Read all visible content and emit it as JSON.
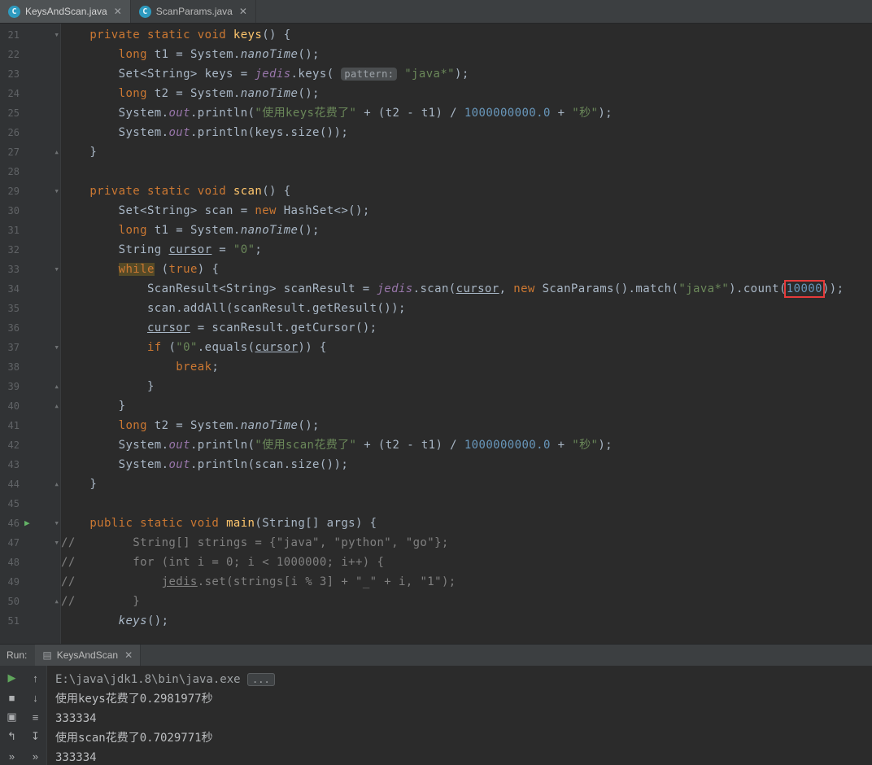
{
  "colors": {
    "editor_bg": "#2b2b2b",
    "gutter_bg": "#313335",
    "tabbar_bg": "#3c3f41",
    "keyword": "#cc7832",
    "string": "#6a8759",
    "number": "#6897bb",
    "field": "#9876aa",
    "comment": "#808080",
    "foreground": "#a9b7c6",
    "method_decl": "#ffc66d",
    "run_green": "#64b467",
    "annotation_red": "#e43b3b"
  },
  "editor_tabs": [
    {
      "label": "KeysAndScan.java",
      "active": true,
      "close": "✕"
    },
    {
      "label": "ScanParams.java",
      "active": false,
      "close": "✕"
    }
  ],
  "editor": {
    "lines": [
      {
        "num": 21,
        "fold": "open",
        "tokens": [
          [
            "kw",
            "    private static void "
          ],
          [
            "fn",
            "keys"
          ],
          [
            "pl",
            "() {"
          ]
        ]
      },
      {
        "num": 22,
        "tokens": [
          [
            "pl",
            "        "
          ],
          [
            "kw",
            "long"
          ],
          [
            "pl",
            " t1 = System."
          ],
          [
            "it",
            "nanoTime"
          ],
          [
            "pl",
            "();"
          ]
        ]
      },
      {
        "num": 23,
        "tokens": [
          [
            "pl",
            "        Set<String> keys = "
          ],
          [
            "field",
            "jedis"
          ],
          [
            "pl",
            ".keys( "
          ],
          [
            "hint",
            "pattern:"
          ],
          [
            "pl",
            " "
          ],
          [
            "str",
            "\"java*\""
          ],
          [
            "pl",
            ");"
          ]
        ]
      },
      {
        "num": 24,
        "tokens": [
          [
            "pl",
            "        "
          ],
          [
            "kw",
            "long"
          ],
          [
            "pl",
            " t2 = System."
          ],
          [
            "it",
            "nanoTime"
          ],
          [
            "pl",
            "();"
          ]
        ]
      },
      {
        "num": 25,
        "tokens": [
          [
            "pl",
            "        System."
          ],
          [
            "field",
            "out"
          ],
          [
            "pl",
            ".println("
          ],
          [
            "str",
            "\"使用keys花费了\""
          ],
          [
            "pl",
            " + (t2 - t1) / "
          ],
          [
            "num",
            "1000000000.0"
          ],
          [
            "pl",
            " + "
          ],
          [
            "str",
            "\"秒\""
          ],
          [
            "pl",
            ");"
          ]
        ]
      },
      {
        "num": 26,
        "tokens": [
          [
            "pl",
            "        System."
          ],
          [
            "field",
            "out"
          ],
          [
            "pl",
            ".println(keys.size());"
          ]
        ]
      },
      {
        "num": 27,
        "fold": "end",
        "tokens": [
          [
            "pl",
            "    }"
          ]
        ]
      },
      {
        "num": 28,
        "tokens": []
      },
      {
        "num": 29,
        "fold": "open",
        "tokens": [
          [
            "kw",
            "    private static void "
          ],
          [
            "fn",
            "scan"
          ],
          [
            "pl",
            "() {"
          ]
        ]
      },
      {
        "num": 30,
        "tokens": [
          [
            "pl",
            "        Set<String> scan = "
          ],
          [
            "kw",
            "new"
          ],
          [
            "pl",
            " HashSet<>();"
          ]
        ]
      },
      {
        "num": 31,
        "tokens": [
          [
            "pl",
            "        "
          ],
          [
            "kw",
            "long"
          ],
          [
            "pl",
            " t1 = System."
          ],
          [
            "it",
            "nanoTime"
          ],
          [
            "pl",
            "();"
          ]
        ]
      },
      {
        "num": 32,
        "tokens": [
          [
            "pl",
            "        String "
          ],
          [
            "ul",
            "cursor"
          ],
          [
            "pl",
            " = "
          ],
          [
            "str",
            "\"0\""
          ],
          [
            "pl",
            ";"
          ]
        ]
      },
      {
        "num": 33,
        "fold": "open",
        "tokens": [
          [
            "pl",
            "        "
          ],
          [
            "kw hl",
            "while"
          ],
          [
            "pl",
            " ("
          ],
          [
            "kw",
            "true"
          ],
          [
            "pl",
            ") {"
          ]
        ]
      },
      {
        "num": 34,
        "tokens": [
          [
            "pl",
            "            ScanResult<String> scanResult = "
          ],
          [
            "field",
            "jedis"
          ],
          [
            "pl",
            ".scan("
          ],
          [
            "ul",
            "cursor"
          ],
          [
            "pl",
            ", "
          ],
          [
            "kw",
            "new"
          ],
          [
            "pl",
            " ScanParams().match("
          ],
          [
            "str",
            "\"java*\""
          ],
          [
            "pl",
            ").count("
          ],
          [
            "num red",
            "10000"
          ],
          [
            "pl",
            "));"
          ]
        ]
      },
      {
        "num": 35,
        "tokens": [
          [
            "pl",
            "            scan.addAll(scanResult.getResult());"
          ]
        ]
      },
      {
        "num": 36,
        "tokens": [
          [
            "pl",
            "            "
          ],
          [
            "ul",
            "cursor"
          ],
          [
            "pl",
            " = scanResult.getCursor();"
          ]
        ]
      },
      {
        "num": 37,
        "fold": "open",
        "tokens": [
          [
            "pl",
            "            "
          ],
          [
            "kw",
            "if"
          ],
          [
            "pl",
            " ("
          ],
          [
            "str",
            "\"0\""
          ],
          [
            "pl",
            ".equals("
          ],
          [
            "ul",
            "cursor"
          ],
          [
            "pl",
            ")) {"
          ]
        ]
      },
      {
        "num": 38,
        "tokens": [
          [
            "pl",
            "                "
          ],
          [
            "kw",
            "break"
          ],
          [
            "pl",
            ";"
          ]
        ]
      },
      {
        "num": 39,
        "fold": "end",
        "tokens": [
          [
            "pl",
            "            }"
          ]
        ]
      },
      {
        "num": 40,
        "fold": "end",
        "tokens": [
          [
            "pl",
            "        }"
          ]
        ]
      },
      {
        "num": 41,
        "tokens": [
          [
            "pl",
            "        "
          ],
          [
            "kw",
            "long"
          ],
          [
            "pl",
            " t2 = System."
          ],
          [
            "it",
            "nanoTime"
          ],
          [
            "pl",
            "();"
          ]
        ]
      },
      {
        "num": 42,
        "tokens": [
          [
            "pl",
            "        System."
          ],
          [
            "field",
            "out"
          ],
          [
            "pl",
            ".println("
          ],
          [
            "str",
            "\"使用scan花费了\""
          ],
          [
            "pl",
            " + (t2 - t1) / "
          ],
          [
            "num",
            "1000000000.0"
          ],
          [
            "pl",
            " + "
          ],
          [
            "str",
            "\"秒\""
          ],
          [
            "pl",
            ");"
          ]
        ]
      },
      {
        "num": 43,
        "tokens": [
          [
            "pl",
            "        System."
          ],
          [
            "field",
            "out"
          ],
          [
            "pl",
            ".println(scan.size());"
          ]
        ]
      },
      {
        "num": 44,
        "fold": "end",
        "tokens": [
          [
            "pl",
            "    }"
          ]
        ]
      },
      {
        "num": 45,
        "tokens": []
      },
      {
        "num": 46,
        "fold": "open",
        "run": true,
        "tokens": [
          [
            "kw",
            "    public static void "
          ],
          [
            "fn",
            "main"
          ],
          [
            "pl",
            "(String[] args) {"
          ]
        ]
      },
      {
        "num": 47,
        "fold": "open",
        "tokens": [
          [
            "cm",
            "//        String[] strings = {\"java\", \"python\", \"go\"};"
          ]
        ]
      },
      {
        "num": 48,
        "tokens": [
          [
            "cm",
            "//        for (int i = 0; i < 1000000; i++) {"
          ]
        ]
      },
      {
        "num": 49,
        "tokens": [
          [
            "cm",
            "//            "
          ],
          [
            "cm ul",
            "jedis"
          ],
          [
            "cm",
            ".set(strings[i % 3] + \"_\" + i, \"1\");"
          ]
        ]
      },
      {
        "num": 50,
        "fold": "end",
        "tokens": [
          [
            "cm",
            "//        }"
          ]
        ]
      },
      {
        "num": 51,
        "tokens": [
          [
            "pl",
            "        "
          ],
          [
            "it",
            "keys"
          ],
          [
            "pl",
            "();"
          ]
        ]
      }
    ]
  },
  "run_panel": {
    "label": "Run:",
    "tab": "KeysAndScan",
    "tab_close": "✕",
    "toolbar": [
      {
        "name": "rerun-icon",
        "glyph": "▶",
        "cls": "green"
      },
      {
        "name": "prev-frame-icon",
        "glyph": "↑",
        "cls": ""
      },
      {
        "name": "stop-icon",
        "glyph": "■",
        "cls": ""
      },
      {
        "name": "next-frame-icon",
        "glyph": "↓",
        "cls": ""
      },
      {
        "name": "screenshot-icon",
        "glyph": "▣",
        "cls": ""
      },
      {
        "name": "soft-wrap-icon",
        "glyph": "≡",
        "cls": ""
      },
      {
        "name": "exit-icon",
        "glyph": "↰",
        "cls": ""
      },
      {
        "name": "scroll-to-end-icon",
        "glyph": "↧",
        "cls": ""
      },
      {
        "name": "more-options-icon",
        "glyph": "»",
        "cls": ""
      },
      {
        "name": "more-actions-icon",
        "glyph": "»",
        "cls": ""
      }
    ]
  },
  "console": {
    "lines": [
      {
        "tokens": [
          [
            "path",
            "E:\\java\\jdk1.8\\bin\\java.exe "
          ],
          [
            "chip",
            "..."
          ]
        ]
      },
      {
        "tokens": [
          [
            "out",
            "使用keys花费了0.2981977秒"
          ]
        ]
      },
      {
        "tokens": [
          [
            "out",
            "333334"
          ]
        ]
      },
      {
        "tokens": [
          [
            "out",
            "使用scan花费了0.7029771秒"
          ]
        ]
      },
      {
        "tokens": [
          [
            "out",
            "333334"
          ]
        ]
      }
    ]
  }
}
